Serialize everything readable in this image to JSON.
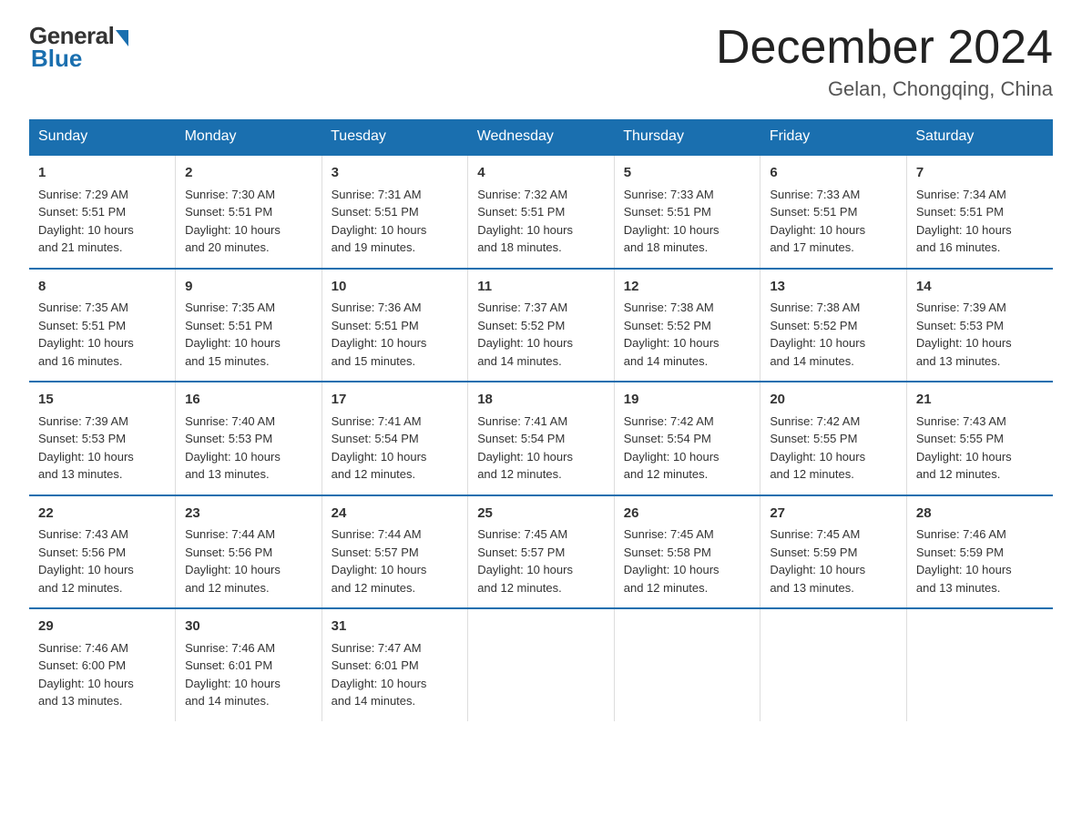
{
  "logo": {
    "general": "General",
    "blue": "Blue"
  },
  "title": "December 2024",
  "location": "Gelan, Chongqing, China",
  "days_of_week": [
    "Sunday",
    "Monday",
    "Tuesday",
    "Wednesday",
    "Thursday",
    "Friday",
    "Saturday"
  ],
  "weeks": [
    [
      {
        "day": "1",
        "info": "Sunrise: 7:29 AM\nSunset: 5:51 PM\nDaylight: 10 hours\nand 21 minutes."
      },
      {
        "day": "2",
        "info": "Sunrise: 7:30 AM\nSunset: 5:51 PM\nDaylight: 10 hours\nand 20 minutes."
      },
      {
        "day": "3",
        "info": "Sunrise: 7:31 AM\nSunset: 5:51 PM\nDaylight: 10 hours\nand 19 minutes."
      },
      {
        "day": "4",
        "info": "Sunrise: 7:32 AM\nSunset: 5:51 PM\nDaylight: 10 hours\nand 18 minutes."
      },
      {
        "day": "5",
        "info": "Sunrise: 7:33 AM\nSunset: 5:51 PM\nDaylight: 10 hours\nand 18 minutes."
      },
      {
        "day": "6",
        "info": "Sunrise: 7:33 AM\nSunset: 5:51 PM\nDaylight: 10 hours\nand 17 minutes."
      },
      {
        "day": "7",
        "info": "Sunrise: 7:34 AM\nSunset: 5:51 PM\nDaylight: 10 hours\nand 16 minutes."
      }
    ],
    [
      {
        "day": "8",
        "info": "Sunrise: 7:35 AM\nSunset: 5:51 PM\nDaylight: 10 hours\nand 16 minutes."
      },
      {
        "day": "9",
        "info": "Sunrise: 7:35 AM\nSunset: 5:51 PM\nDaylight: 10 hours\nand 15 minutes."
      },
      {
        "day": "10",
        "info": "Sunrise: 7:36 AM\nSunset: 5:51 PM\nDaylight: 10 hours\nand 15 minutes."
      },
      {
        "day": "11",
        "info": "Sunrise: 7:37 AM\nSunset: 5:52 PM\nDaylight: 10 hours\nand 14 minutes."
      },
      {
        "day": "12",
        "info": "Sunrise: 7:38 AM\nSunset: 5:52 PM\nDaylight: 10 hours\nand 14 minutes."
      },
      {
        "day": "13",
        "info": "Sunrise: 7:38 AM\nSunset: 5:52 PM\nDaylight: 10 hours\nand 14 minutes."
      },
      {
        "day": "14",
        "info": "Sunrise: 7:39 AM\nSunset: 5:53 PM\nDaylight: 10 hours\nand 13 minutes."
      }
    ],
    [
      {
        "day": "15",
        "info": "Sunrise: 7:39 AM\nSunset: 5:53 PM\nDaylight: 10 hours\nand 13 minutes."
      },
      {
        "day": "16",
        "info": "Sunrise: 7:40 AM\nSunset: 5:53 PM\nDaylight: 10 hours\nand 13 minutes."
      },
      {
        "day": "17",
        "info": "Sunrise: 7:41 AM\nSunset: 5:54 PM\nDaylight: 10 hours\nand 12 minutes."
      },
      {
        "day": "18",
        "info": "Sunrise: 7:41 AM\nSunset: 5:54 PM\nDaylight: 10 hours\nand 12 minutes."
      },
      {
        "day": "19",
        "info": "Sunrise: 7:42 AM\nSunset: 5:54 PM\nDaylight: 10 hours\nand 12 minutes."
      },
      {
        "day": "20",
        "info": "Sunrise: 7:42 AM\nSunset: 5:55 PM\nDaylight: 10 hours\nand 12 minutes."
      },
      {
        "day": "21",
        "info": "Sunrise: 7:43 AM\nSunset: 5:55 PM\nDaylight: 10 hours\nand 12 minutes."
      }
    ],
    [
      {
        "day": "22",
        "info": "Sunrise: 7:43 AM\nSunset: 5:56 PM\nDaylight: 10 hours\nand 12 minutes."
      },
      {
        "day": "23",
        "info": "Sunrise: 7:44 AM\nSunset: 5:56 PM\nDaylight: 10 hours\nand 12 minutes."
      },
      {
        "day": "24",
        "info": "Sunrise: 7:44 AM\nSunset: 5:57 PM\nDaylight: 10 hours\nand 12 minutes."
      },
      {
        "day": "25",
        "info": "Sunrise: 7:45 AM\nSunset: 5:57 PM\nDaylight: 10 hours\nand 12 minutes."
      },
      {
        "day": "26",
        "info": "Sunrise: 7:45 AM\nSunset: 5:58 PM\nDaylight: 10 hours\nand 12 minutes."
      },
      {
        "day": "27",
        "info": "Sunrise: 7:45 AM\nSunset: 5:59 PM\nDaylight: 10 hours\nand 13 minutes."
      },
      {
        "day": "28",
        "info": "Sunrise: 7:46 AM\nSunset: 5:59 PM\nDaylight: 10 hours\nand 13 minutes."
      }
    ],
    [
      {
        "day": "29",
        "info": "Sunrise: 7:46 AM\nSunset: 6:00 PM\nDaylight: 10 hours\nand 13 minutes."
      },
      {
        "day": "30",
        "info": "Sunrise: 7:46 AM\nSunset: 6:01 PM\nDaylight: 10 hours\nand 14 minutes."
      },
      {
        "day": "31",
        "info": "Sunrise: 7:47 AM\nSunset: 6:01 PM\nDaylight: 10 hours\nand 14 minutes."
      },
      {
        "day": "",
        "info": ""
      },
      {
        "day": "",
        "info": ""
      },
      {
        "day": "",
        "info": ""
      },
      {
        "day": "",
        "info": ""
      }
    ]
  ]
}
